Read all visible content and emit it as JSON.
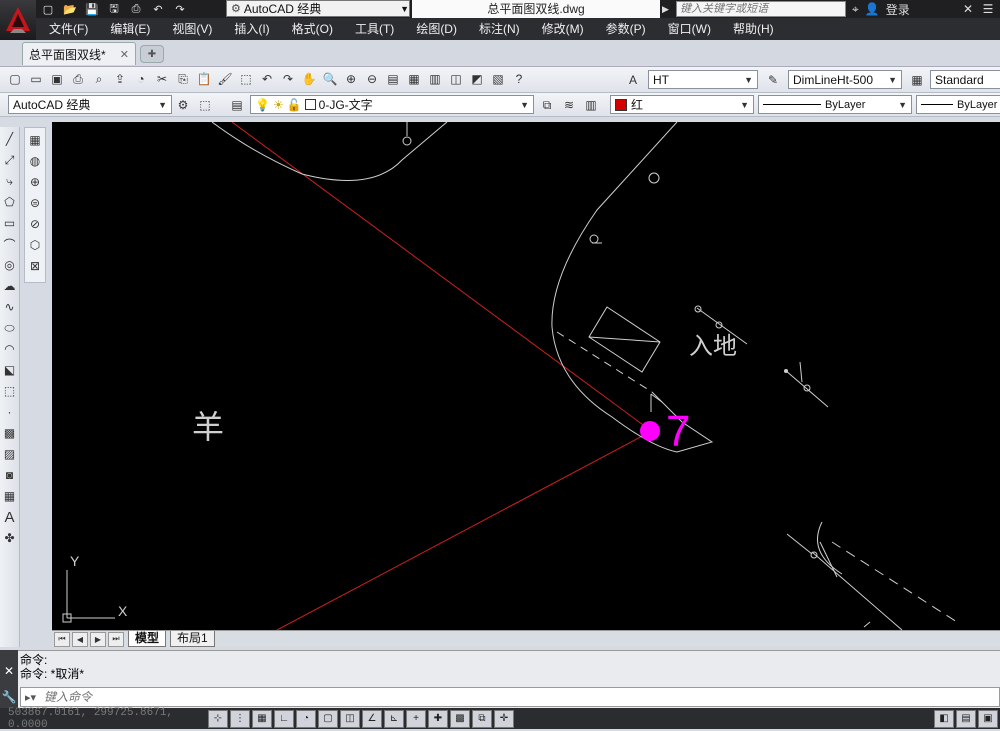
{
  "window": {
    "workspace": "AutoCAD 经典",
    "document_title": "总平面图双线.dwg",
    "search_placeholder": "键入关键字或短语",
    "login_label": "登录"
  },
  "menu": [
    "文件(F)",
    "编辑(E)",
    "视图(V)",
    "插入(I)",
    "格式(O)",
    "工具(T)",
    "绘图(D)",
    "标注(N)",
    "修改(M)",
    "参数(P)",
    "窗口(W)",
    "帮助(H)"
  ],
  "file_tab": {
    "label": "总平面图双线*"
  },
  "toolbar_styles": {
    "text_style": "HT",
    "dim_style": "DimLineHt-500",
    "table_style": "Standard"
  },
  "toolbar_layers": {
    "workspace": "AutoCAD 经典",
    "layer": "0-JG-文字",
    "color": "红",
    "color_swatch": "#d40000",
    "linetype": "ByLayer",
    "lineweight": "ByLayer"
  },
  "canvas": {
    "text_label_1": "羊",
    "text_label_2": "入地",
    "marker_label": "7",
    "marker_color": "#ff00ff",
    "ucs_x": "X",
    "ucs_y": "Y",
    "line_color": "#cc2020",
    "geometry_color": "#cfcfcf"
  },
  "layout_tabs": [
    {
      "label": "模型",
      "active": true
    },
    {
      "label": "布局1",
      "active": false
    }
  ],
  "command": {
    "history": [
      "命令:",
      "命令: *取消*"
    ],
    "input_placeholder": "键入命令"
  },
  "status": {
    "coordinates": "503867.0161, 299725.8671, 0.0000"
  }
}
